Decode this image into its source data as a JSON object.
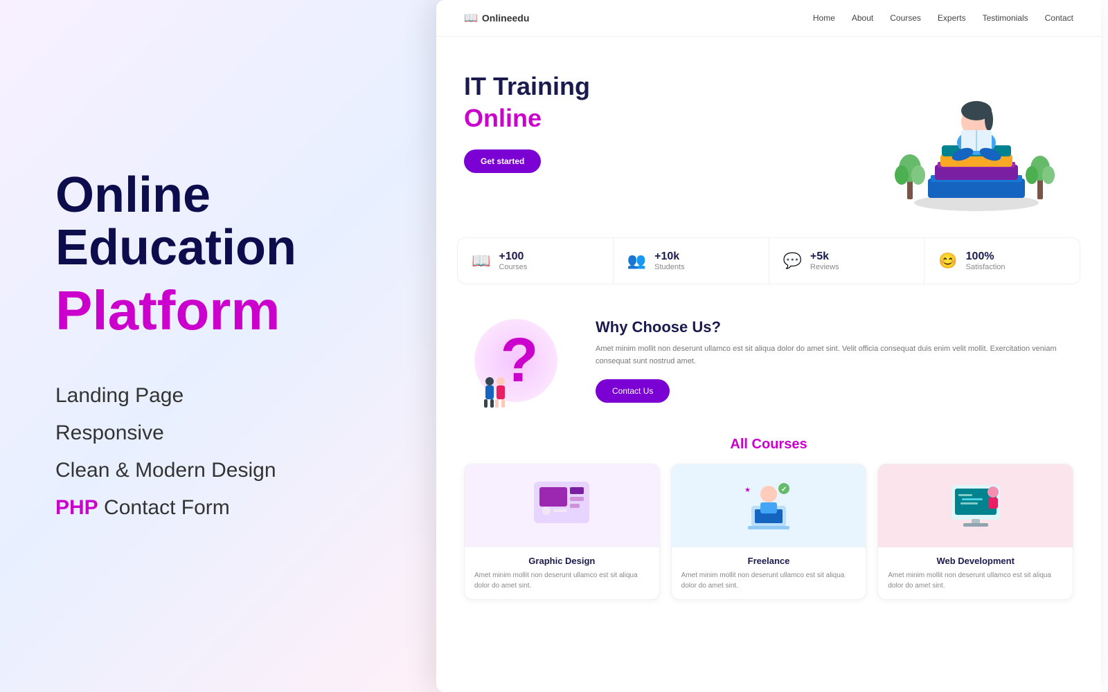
{
  "left": {
    "title_line1": "Online",
    "title_line2": "Education",
    "title_line3": "Platform",
    "features": [
      {
        "text": "Landing Page",
        "highlight": ""
      },
      {
        "text": "Responsive",
        "highlight": ""
      },
      {
        "text": "Clean & Modern Design",
        "highlight": ""
      },
      {
        "text_before": "",
        "text_after": " Contact Form",
        "highlight": "PHP"
      }
    ]
  },
  "navbar": {
    "brand": "Onlineedu",
    "nav_items": [
      "Home",
      "About",
      "Courses",
      "Experts",
      "Testimonials",
      "Contact"
    ]
  },
  "hero": {
    "title_line1": "IT Training",
    "title_line2": "Online",
    "cta_button": "Get started"
  },
  "stats": [
    {
      "number": "+100",
      "label": "Courses",
      "icon": "📖"
    },
    {
      "number": "+10k",
      "label": "Students",
      "icon": "👥"
    },
    {
      "number": "+5k",
      "label": "Reviews",
      "icon": "💬"
    },
    {
      "number": "100%",
      "label": "Satisfaction",
      "icon": "😊"
    }
  ],
  "why_choose": {
    "title": "Why Choose Us?",
    "description": "Amet minim mollit non deserunt ullamco est sit aliqua dolor do amet sint. Velit officia consequat duis enim velit mollit. Exercitation veniam consequat sunt nostrud amet.",
    "cta_button": "Contact Us"
  },
  "courses": {
    "title_before": "All ",
    "title_highlight": "Courses",
    "items": [
      {
        "title": "Graphic Design",
        "description": "Amet minim mollit non deserunt ullamco est sit aliqua dolor do amet sint."
      },
      {
        "title": "Freelance",
        "description": "Amet minim mollit non deserunt ullamco est sit aliqua dolor do amet sint."
      },
      {
        "title": "Web Development",
        "description": "Amet minim mollit non deserunt ullamco est sit aliqua dolor do amet sint."
      }
    ]
  }
}
